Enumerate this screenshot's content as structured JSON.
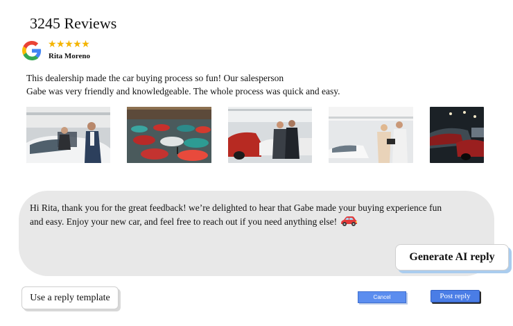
{
  "header": {
    "title": "3245 Reviews"
  },
  "review": {
    "stars": "★★★★★",
    "rating": 5,
    "reviewer": "Rita Moreno",
    "text_line1": "This dealership made the car buying process so fun! Our salesperson",
    "text_line2": "Gabe was very friendly and knowledgeable. The whole process was quick and easy."
  },
  "photos": [
    {
      "icon": "photo-couple-car-door"
    },
    {
      "icon": "photo-showroom-floor"
    },
    {
      "icon": "photo-salesmen-red-car"
    },
    {
      "icon": "photo-tablet-showroom"
    },
    {
      "icon": "photo-dark-showroom"
    }
  ],
  "reply": {
    "line1": "Hi Rita, thank you for the great feedback! we’re delighted to hear that Gabe made your buying experience fun",
    "line2": "and easy. Enjoy your new car, and feel free to reach out if you need anything else!",
    "emoji_icon": "red-car-icon"
  },
  "actions": {
    "generate_label": "Generate AI reply",
    "template_label": "Use a reply template",
    "cancel_label": "Cancel",
    "post_label": "Post reply"
  },
  "colors": {
    "star": "#f4b400",
    "reply_bg": "#e8e8e8",
    "button_blue": "#4a7de6"
  }
}
